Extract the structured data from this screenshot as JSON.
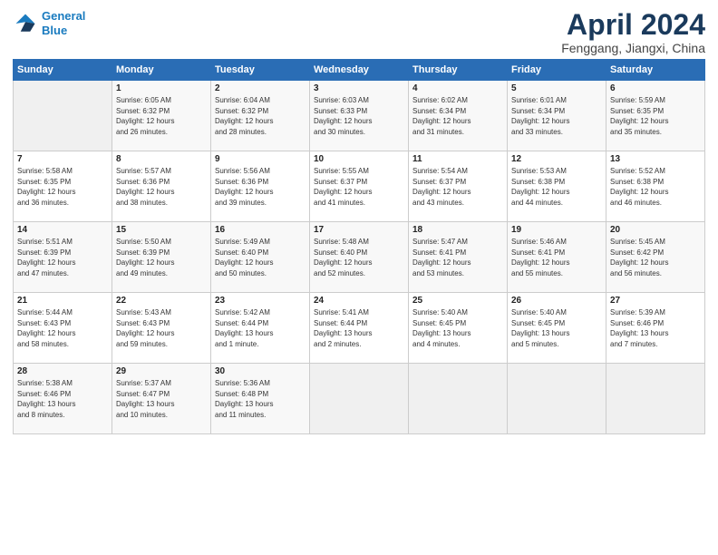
{
  "header": {
    "logo_line1": "General",
    "logo_line2": "Blue",
    "title": "April 2024",
    "subtitle": "Fenggang, Jiangxi, China"
  },
  "columns": [
    "Sunday",
    "Monday",
    "Tuesday",
    "Wednesday",
    "Thursday",
    "Friday",
    "Saturday"
  ],
  "weeks": [
    [
      {
        "day": "",
        "info": ""
      },
      {
        "day": "1",
        "info": "Sunrise: 6:05 AM\nSunset: 6:32 PM\nDaylight: 12 hours\nand 26 minutes."
      },
      {
        "day": "2",
        "info": "Sunrise: 6:04 AM\nSunset: 6:32 PM\nDaylight: 12 hours\nand 28 minutes."
      },
      {
        "day": "3",
        "info": "Sunrise: 6:03 AM\nSunset: 6:33 PM\nDaylight: 12 hours\nand 30 minutes."
      },
      {
        "day": "4",
        "info": "Sunrise: 6:02 AM\nSunset: 6:34 PM\nDaylight: 12 hours\nand 31 minutes."
      },
      {
        "day": "5",
        "info": "Sunrise: 6:01 AM\nSunset: 6:34 PM\nDaylight: 12 hours\nand 33 minutes."
      },
      {
        "day": "6",
        "info": "Sunrise: 5:59 AM\nSunset: 6:35 PM\nDaylight: 12 hours\nand 35 minutes."
      }
    ],
    [
      {
        "day": "7",
        "info": "Sunrise: 5:58 AM\nSunset: 6:35 PM\nDaylight: 12 hours\nand 36 minutes."
      },
      {
        "day": "8",
        "info": "Sunrise: 5:57 AM\nSunset: 6:36 PM\nDaylight: 12 hours\nand 38 minutes."
      },
      {
        "day": "9",
        "info": "Sunrise: 5:56 AM\nSunset: 6:36 PM\nDaylight: 12 hours\nand 39 minutes."
      },
      {
        "day": "10",
        "info": "Sunrise: 5:55 AM\nSunset: 6:37 PM\nDaylight: 12 hours\nand 41 minutes."
      },
      {
        "day": "11",
        "info": "Sunrise: 5:54 AM\nSunset: 6:37 PM\nDaylight: 12 hours\nand 43 minutes."
      },
      {
        "day": "12",
        "info": "Sunrise: 5:53 AM\nSunset: 6:38 PM\nDaylight: 12 hours\nand 44 minutes."
      },
      {
        "day": "13",
        "info": "Sunrise: 5:52 AM\nSunset: 6:38 PM\nDaylight: 12 hours\nand 46 minutes."
      }
    ],
    [
      {
        "day": "14",
        "info": "Sunrise: 5:51 AM\nSunset: 6:39 PM\nDaylight: 12 hours\nand 47 minutes."
      },
      {
        "day": "15",
        "info": "Sunrise: 5:50 AM\nSunset: 6:39 PM\nDaylight: 12 hours\nand 49 minutes."
      },
      {
        "day": "16",
        "info": "Sunrise: 5:49 AM\nSunset: 6:40 PM\nDaylight: 12 hours\nand 50 minutes."
      },
      {
        "day": "17",
        "info": "Sunrise: 5:48 AM\nSunset: 6:40 PM\nDaylight: 12 hours\nand 52 minutes."
      },
      {
        "day": "18",
        "info": "Sunrise: 5:47 AM\nSunset: 6:41 PM\nDaylight: 12 hours\nand 53 minutes."
      },
      {
        "day": "19",
        "info": "Sunrise: 5:46 AM\nSunset: 6:41 PM\nDaylight: 12 hours\nand 55 minutes."
      },
      {
        "day": "20",
        "info": "Sunrise: 5:45 AM\nSunset: 6:42 PM\nDaylight: 12 hours\nand 56 minutes."
      }
    ],
    [
      {
        "day": "21",
        "info": "Sunrise: 5:44 AM\nSunset: 6:43 PM\nDaylight: 12 hours\nand 58 minutes."
      },
      {
        "day": "22",
        "info": "Sunrise: 5:43 AM\nSunset: 6:43 PM\nDaylight: 12 hours\nand 59 minutes."
      },
      {
        "day": "23",
        "info": "Sunrise: 5:42 AM\nSunset: 6:44 PM\nDaylight: 13 hours\nand 1 minute."
      },
      {
        "day": "24",
        "info": "Sunrise: 5:41 AM\nSunset: 6:44 PM\nDaylight: 13 hours\nand 2 minutes."
      },
      {
        "day": "25",
        "info": "Sunrise: 5:40 AM\nSunset: 6:45 PM\nDaylight: 13 hours\nand 4 minutes."
      },
      {
        "day": "26",
        "info": "Sunrise: 5:40 AM\nSunset: 6:45 PM\nDaylight: 13 hours\nand 5 minutes."
      },
      {
        "day": "27",
        "info": "Sunrise: 5:39 AM\nSunset: 6:46 PM\nDaylight: 13 hours\nand 7 minutes."
      }
    ],
    [
      {
        "day": "28",
        "info": "Sunrise: 5:38 AM\nSunset: 6:46 PM\nDaylight: 13 hours\nand 8 minutes."
      },
      {
        "day": "29",
        "info": "Sunrise: 5:37 AM\nSunset: 6:47 PM\nDaylight: 13 hours\nand 10 minutes."
      },
      {
        "day": "30",
        "info": "Sunrise: 5:36 AM\nSunset: 6:48 PM\nDaylight: 13 hours\nand 11 minutes."
      },
      {
        "day": "",
        "info": ""
      },
      {
        "day": "",
        "info": ""
      },
      {
        "day": "",
        "info": ""
      },
      {
        "day": "",
        "info": ""
      }
    ]
  ]
}
